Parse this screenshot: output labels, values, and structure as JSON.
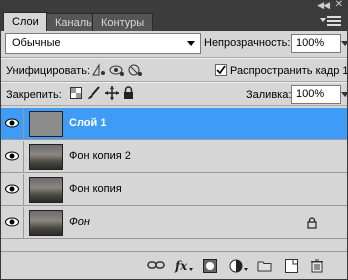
{
  "tabs": [
    {
      "label": "Слои",
      "active": true
    },
    {
      "label": "Каналы",
      "active": false
    },
    {
      "label": "Контуры",
      "active": false
    }
  ],
  "blend_mode": {
    "value": "Обычные"
  },
  "opacity": {
    "label": "Непрозрачность:",
    "value": "100%"
  },
  "unify": {
    "label": "Унифицировать:"
  },
  "propagate": {
    "label": "Распространить кадр 1",
    "checked": true
  },
  "lock": {
    "label": "Закрепить:"
  },
  "fill": {
    "label": "Заливка:",
    "value": "100%"
  },
  "layers": [
    {
      "name": "Слой 1",
      "selected": true,
      "thumb": "gray",
      "locked": false
    },
    {
      "name": "Фон копия 2",
      "selected": false,
      "thumb": "photo",
      "locked": false
    },
    {
      "name": "Фон копия",
      "selected": false,
      "thumb": "photo",
      "locked": false
    },
    {
      "name": "Фон",
      "selected": false,
      "thumb": "photo",
      "locked": true
    }
  ],
  "bottom_icons": [
    "link-icon",
    "fx-icon",
    "mask-icon",
    "adjustment-icon",
    "folder-icon",
    "new-layer-icon",
    "trash-icon"
  ],
  "colors": {
    "selection": "#3e9cf7",
    "panel": "#d6d6d6",
    "header": "#3c3c3c"
  }
}
